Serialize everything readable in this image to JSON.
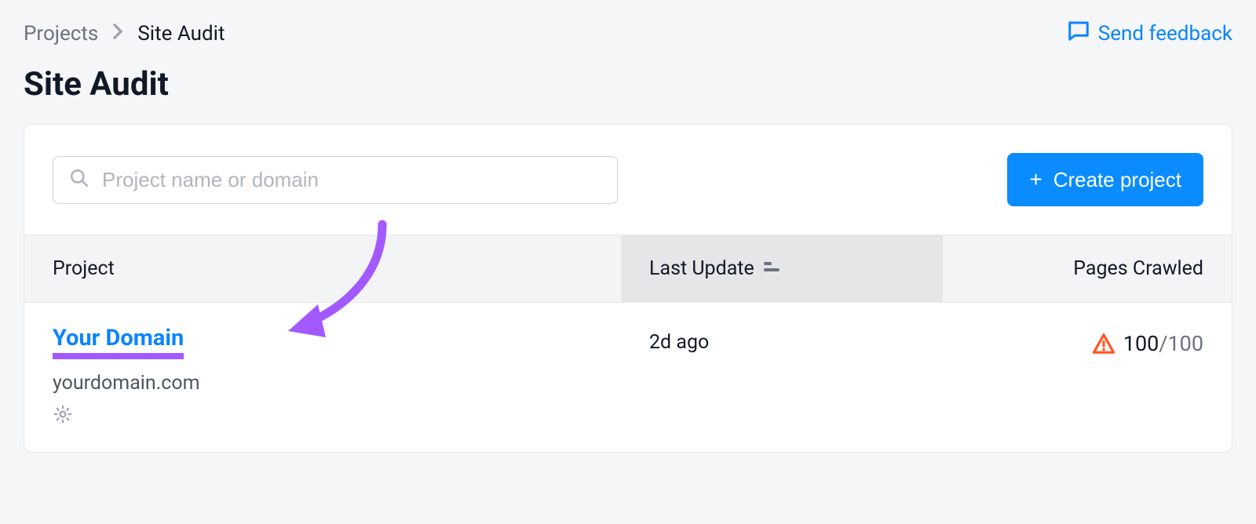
{
  "breadcrumb": {
    "root": "Projects",
    "current": "Site Audit"
  },
  "feedback": {
    "label": "Send feedback"
  },
  "page": {
    "title": "Site Audit"
  },
  "search": {
    "placeholder": "Project name or domain"
  },
  "createButton": {
    "label": "Create project"
  },
  "columns": {
    "project": "Project",
    "lastUpdate": "Last Update",
    "pagesCrawled": "Pages Crawled"
  },
  "rows": [
    {
      "name": "Your Domain",
      "domain": "yourdomain.com",
      "lastUpdate": "2d ago",
      "pagesCrawled": "100",
      "pagesTotal": "/100"
    }
  ],
  "colors": {
    "accent": "#0a84ff",
    "primaryButton": "#0a8cff",
    "highlight": "#a259ff",
    "warning": "#ff5722"
  }
}
